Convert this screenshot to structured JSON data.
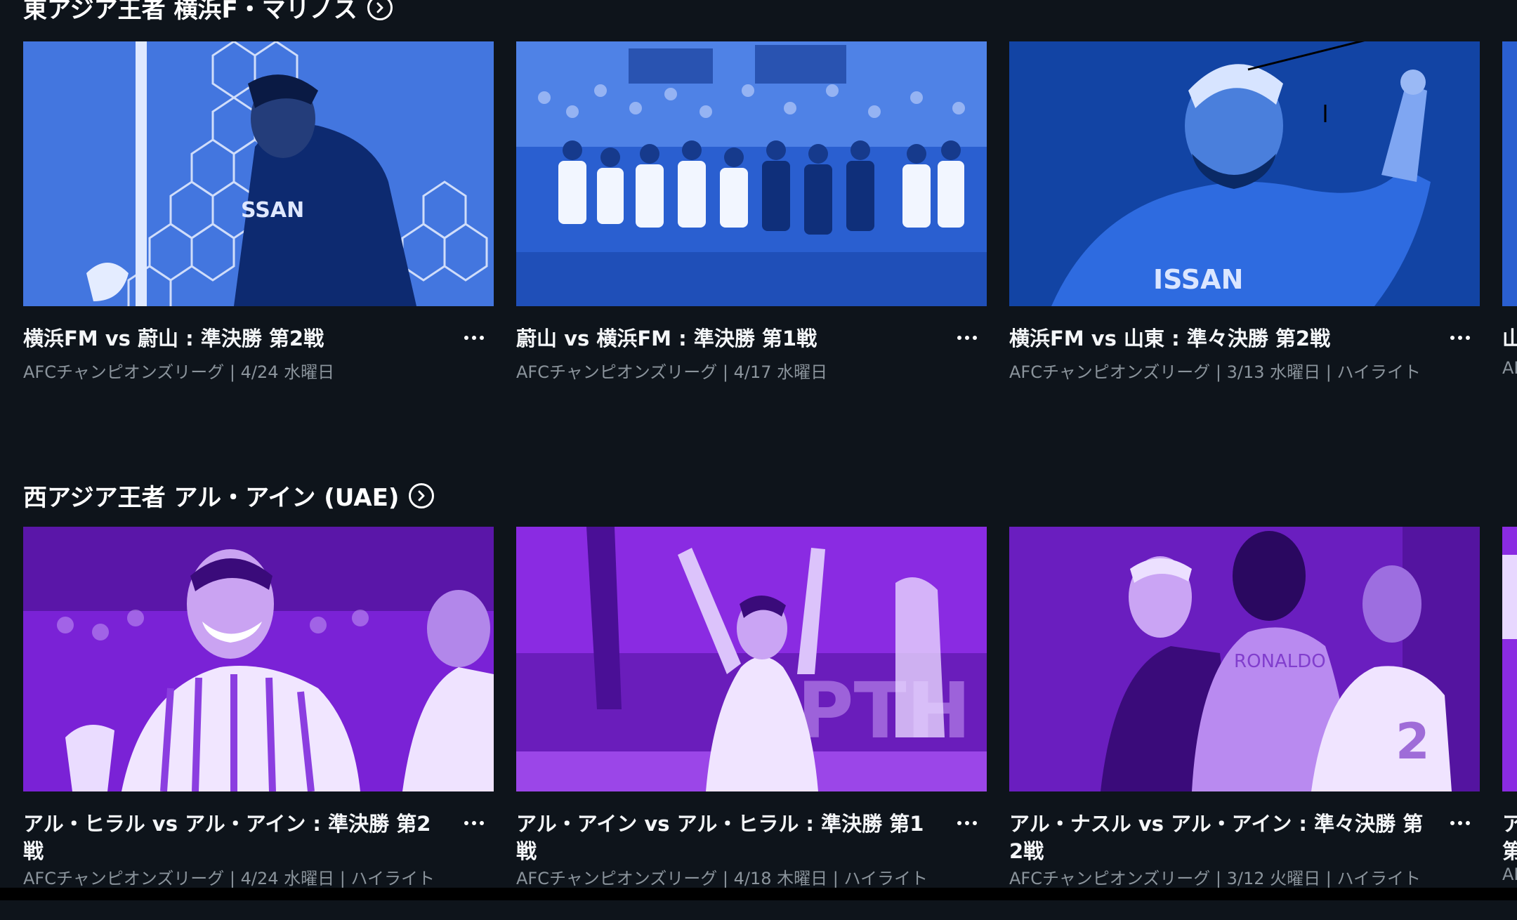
{
  "sections": [
    {
      "title": "東アジア王者 横浜F・マリノス",
      "items": [
        {
          "title": "横浜FM vs 蔚山 : 準決勝 第2戦",
          "meta": "AFCチャンピオンズリーグ | 4/24 水曜日"
        },
        {
          "title": "蔚山 vs 横浜FM : 準決勝 第1戦",
          "meta": "AFCチャンピオンズリーグ | 4/17 水曜日"
        },
        {
          "title": "横浜FM vs 山東 : 準々決勝 第2戦",
          "meta": "AFCチャンピオンズリーグ | 3/13 水曜日 | ハイライト"
        },
        {
          "title": "山",
          "meta": "AF"
        }
      ]
    },
    {
      "title": "西アジア王者 アル・アイン (UAE)",
      "items": [
        {
          "title": "アル・ヒラル vs アル・アイン : 準決勝 第2戦",
          "meta": "AFCチャンピオンズリーグ | 4/24 水曜日 | ハイライト"
        },
        {
          "title": "アル・アイン vs アル・ヒラル : 準決勝 第1戦",
          "meta": "AFCチャンピオンズリーグ | 4/18 木曜日 | ハイライト"
        },
        {
          "title": "アル・ナスル vs アル・アイン : 準々決勝 第2戦",
          "meta": "AFCチャンピオンズリーグ | 3/12 火曜日 | ハイライト"
        },
        {
          "title": "ア 第",
          "meta": "AF"
        }
      ]
    }
  ],
  "icons": {
    "section_link": "chevron-right-circle-icon",
    "more": "more-horizontal-icon"
  },
  "colors": {
    "background": "#0e141b",
    "blue_tint": "#2a5fd0",
    "purple_tint": "#8a2be2",
    "meta_text": "#8b949c"
  }
}
